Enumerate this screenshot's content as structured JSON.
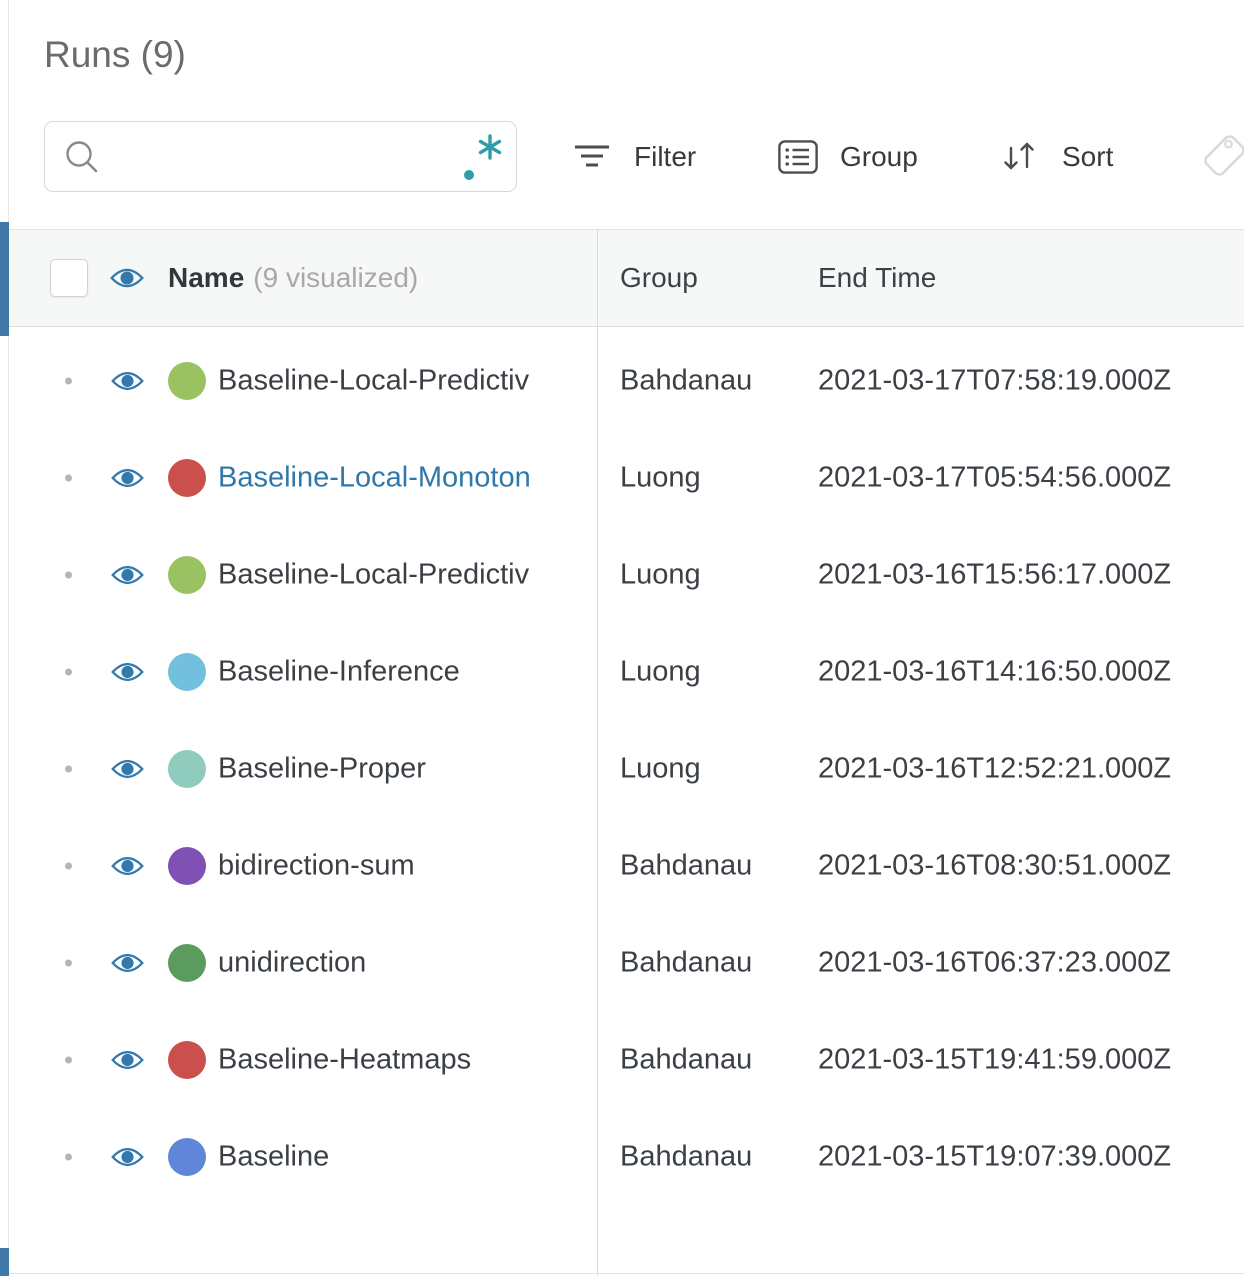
{
  "panel": {
    "title": "Runs (9)"
  },
  "search": {
    "value": "",
    "placeholder": ""
  },
  "toolbar": {
    "filter_label": "Filter",
    "group_label": "Group",
    "sort_label": "Sort"
  },
  "table": {
    "header": {
      "name_label": "Name",
      "name_suffix": "(9 visualized)",
      "group_label": "Group",
      "end_time_label": "End Time"
    },
    "rows": [
      {
        "name": "Baseline-Local-Predictiv",
        "color": "#9ac162",
        "group": "Bahdanau",
        "end_time": "2021-03-17T07:58:19.000Z",
        "link": false
      },
      {
        "name": "Baseline-Local-Monoton",
        "color": "#cb4f4d",
        "group": "Luong",
        "end_time": "2021-03-17T05:54:56.000Z",
        "link": true
      },
      {
        "name": "Baseline-Local-Predictiv",
        "color": "#9ac162",
        "group": "Luong",
        "end_time": "2021-03-16T15:56:17.000Z",
        "link": false
      },
      {
        "name": "Baseline-Inference",
        "color": "#72c0dd",
        "group": "Luong",
        "end_time": "2021-03-16T14:16:50.000Z",
        "link": false
      },
      {
        "name": "Baseline-Proper",
        "color": "#8fccbd",
        "group": "Luong",
        "end_time": "2021-03-16T12:52:21.000Z",
        "link": false
      },
      {
        "name": "bidirection-sum",
        "color": "#7e51b2",
        "group": "Bahdanau",
        "end_time": "2021-03-16T08:30:51.000Z",
        "link": false
      },
      {
        "name": "unidirection",
        "color": "#5b9b5d",
        "group": "Bahdanau",
        "end_time": "2021-03-16T06:37:23.000Z",
        "link": false
      },
      {
        "name": "Baseline-Heatmaps",
        "color": "#cb4f4d",
        "group": "Bahdanau",
        "end_time": "2021-03-15T19:41:59.000Z",
        "link": false
      },
      {
        "name": "Baseline",
        "color": "#5f86d8",
        "group": "Bahdanau",
        "end_time": "2021-03-15T19:07:39.000Z",
        "link": false
      }
    ]
  },
  "icons": {
    "search": "magnifier",
    "regex": "dot-asterisk",
    "filter": "funnel-lines",
    "group": "list-box",
    "sort": "down-up-arrows",
    "tag": "price-tag",
    "visibility": "eye"
  },
  "colors": {
    "accent_eye_blue": "#3279ae",
    "selection_bar_blue": "#4078a8",
    "link_blue": "#2e78ab",
    "regex_teal": "#2d9daa",
    "header_bg": "#f6f7f7",
    "row_text": "#3b4046",
    "title_gray": "#6b6b6b",
    "muted_gray": "#a8a8a8"
  }
}
